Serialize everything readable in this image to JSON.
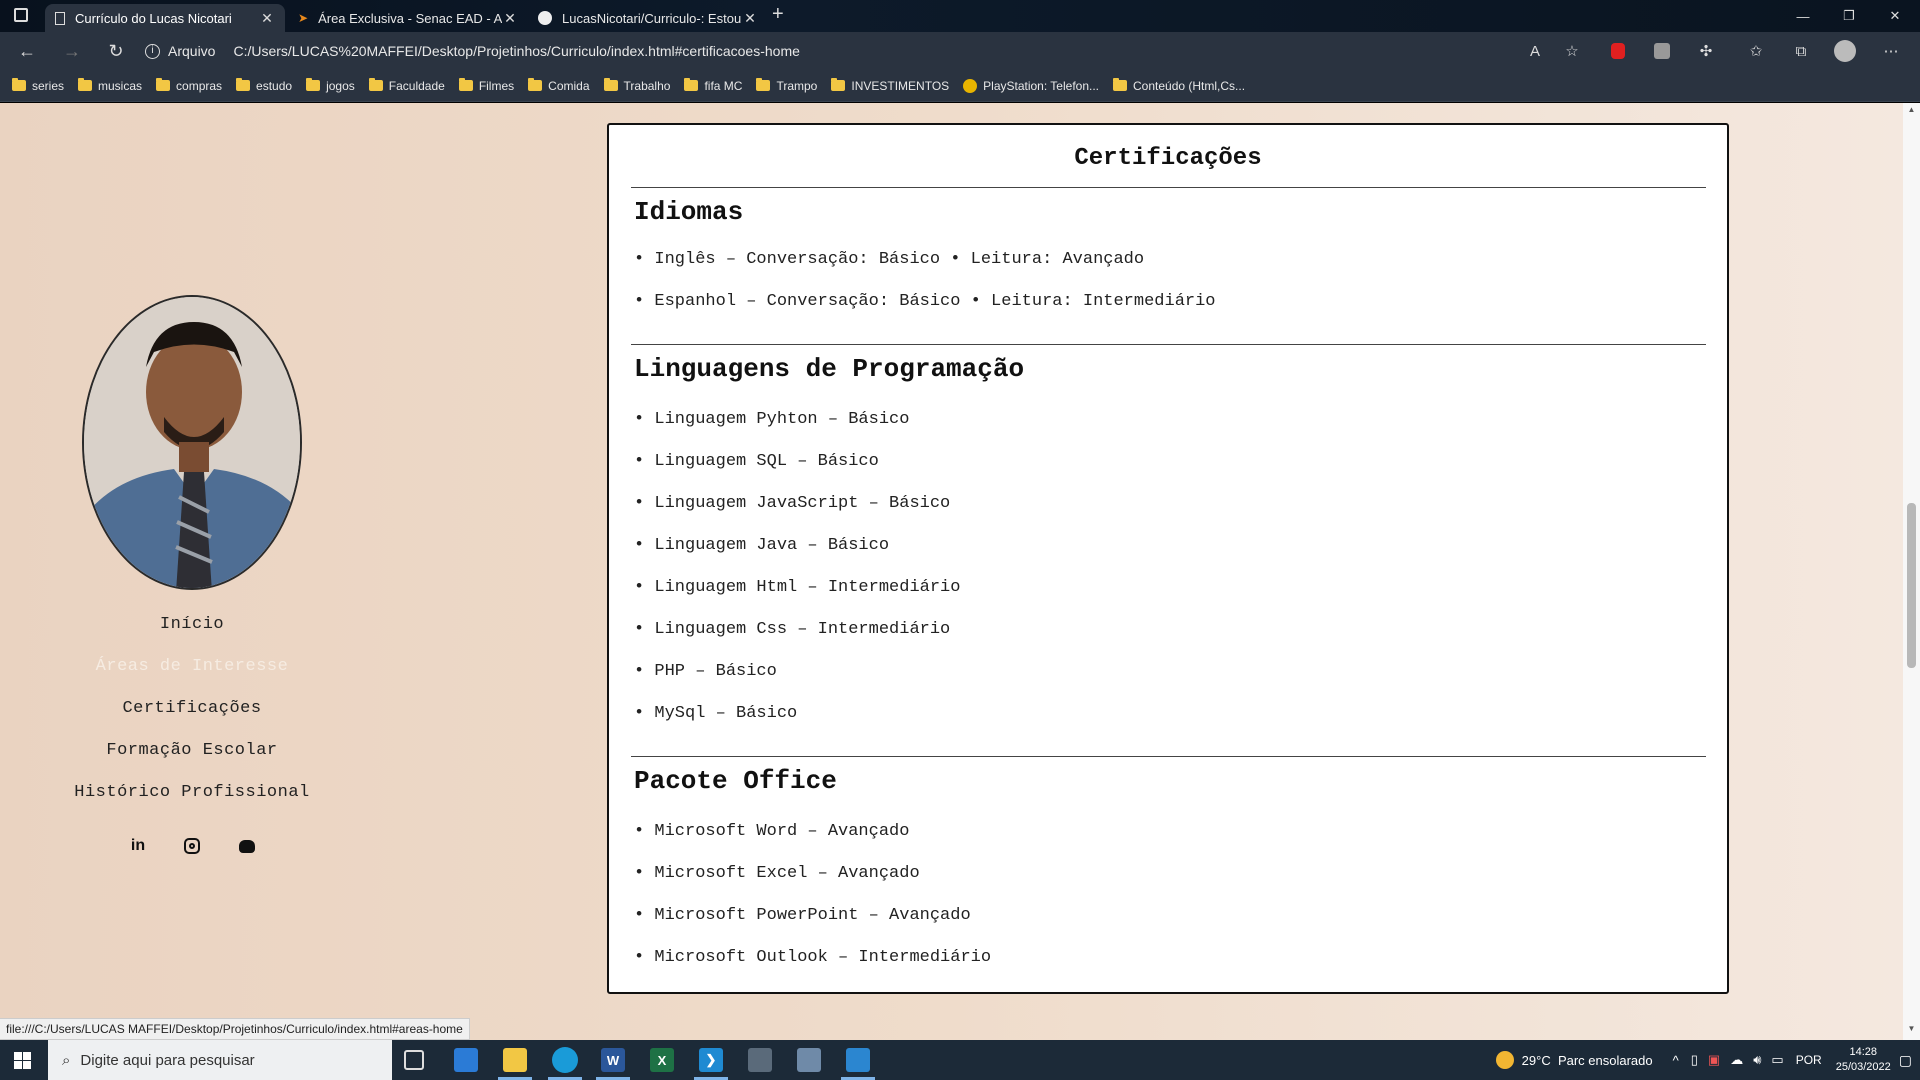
{
  "browser": {
    "tabs": [
      {
        "title": "Currículo do Lucas Nicotari",
        "active": true
      },
      {
        "title": "Área Exclusiva - Senac EAD - Alu",
        "active": false
      },
      {
        "title": "LucasNicotari/Curriculo-: Estou n",
        "active": false
      }
    ],
    "new_tab": "+",
    "address": {
      "label": "Arquivo",
      "url": "C:/Users/LUCAS%20MAFFEI/Desktop/Projetinhos/Curriculo/index.html#certificacoes-home"
    },
    "bookmarks": [
      "series",
      "musicas",
      "compras",
      "estudo",
      "jogos",
      "Faculdade",
      "Filmes",
      "Comida",
      "Trabalho",
      "fifa MC",
      "Trampo",
      "INVESTIMENTOS",
      "PlayStation: Telefon...",
      "Conteúdo (Html,Cs..."
    ]
  },
  "sidebar": {
    "nav": [
      "Início",
      "Áreas de Interesse",
      "Certificações",
      "Formação Escolar",
      "Histórico Profissional"
    ],
    "social": [
      "linkedin-icon",
      "instagram-icon",
      "github-icon"
    ]
  },
  "card": {
    "title": "Certificações",
    "sections": [
      {
        "heading": "Idiomas",
        "items": [
          "• Inglês – Conversação: Básico • Leitura: Avançado",
          "• Espanhol – Conversação: Básico • Leitura: Intermediário"
        ]
      },
      {
        "heading": "Linguagens de Programação",
        "items": [
          "• Linguagem Pyhton – Básico",
          "• Linguagem SQL – Básico",
          "• Linguagem JavaScript – Básico",
          "• Linguagem Java – Básico",
          "• Linguagem Html – Intermediário",
          "• Linguagem Css – Intermediário",
          "• PHP – Básico",
          "• MySql – Básico"
        ]
      },
      {
        "heading": "Pacote Office",
        "items": [
          "• Microsoft Word – Avançado",
          "• Microsoft Excel – Avançado",
          "• Microsoft PowerPoint – Avançado",
          "• Microsoft Outlook – Intermediário"
        ]
      }
    ]
  },
  "status_url": "file:///C:/Users/LUCAS MAFFEI/Desktop/Projetinhos/Curriculo/index.html#areas-home",
  "taskbar": {
    "search_placeholder": "Digite aqui para pesquisar",
    "weather": "29°C  Parc ensolarado",
    "lang": "POR",
    "time": "14:28",
    "date": "25/03/2022"
  }
}
